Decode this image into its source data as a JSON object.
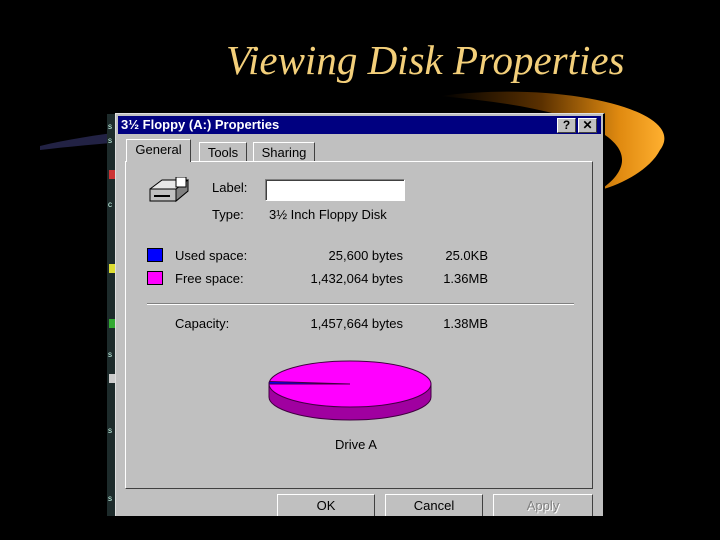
{
  "slide": {
    "title": "Viewing Disk Properties"
  },
  "window": {
    "title": "3½ Floppy (A:) Properties",
    "help_glyph": "?",
    "close_glyph": "✕"
  },
  "tabs": [
    {
      "label": "General",
      "active": true
    },
    {
      "label": "Tools",
      "active": false
    },
    {
      "label": "Sharing",
      "active": false
    }
  ],
  "general": {
    "drive_icon": "floppy-drive-icon",
    "label_caption": "Label:",
    "label_value": "",
    "type_caption": "Type:",
    "type_value": "3½ Inch Floppy Disk",
    "used": {
      "caption": "Used space:",
      "bytes": "25,600 bytes",
      "size": "25.0KB",
      "color": "#0000ff"
    },
    "free": {
      "caption": "Free space:",
      "bytes": "1,432,064 bytes",
      "size": "1.36MB",
      "color": "#ff00ff"
    },
    "capacity": {
      "caption": "Capacity:",
      "bytes": "1,457,664 bytes",
      "size": "1.38MB"
    },
    "pie_caption": "Drive A",
    "used_fraction": 0.0176
  },
  "buttons": {
    "ok": "OK",
    "cancel": "Cancel",
    "apply": "Apply"
  },
  "colors": {
    "titlebar": "#000080",
    "dialog": "#c0c0c0",
    "slide_title": "#f3cf7a",
    "swoosh": "#e08a10"
  }
}
